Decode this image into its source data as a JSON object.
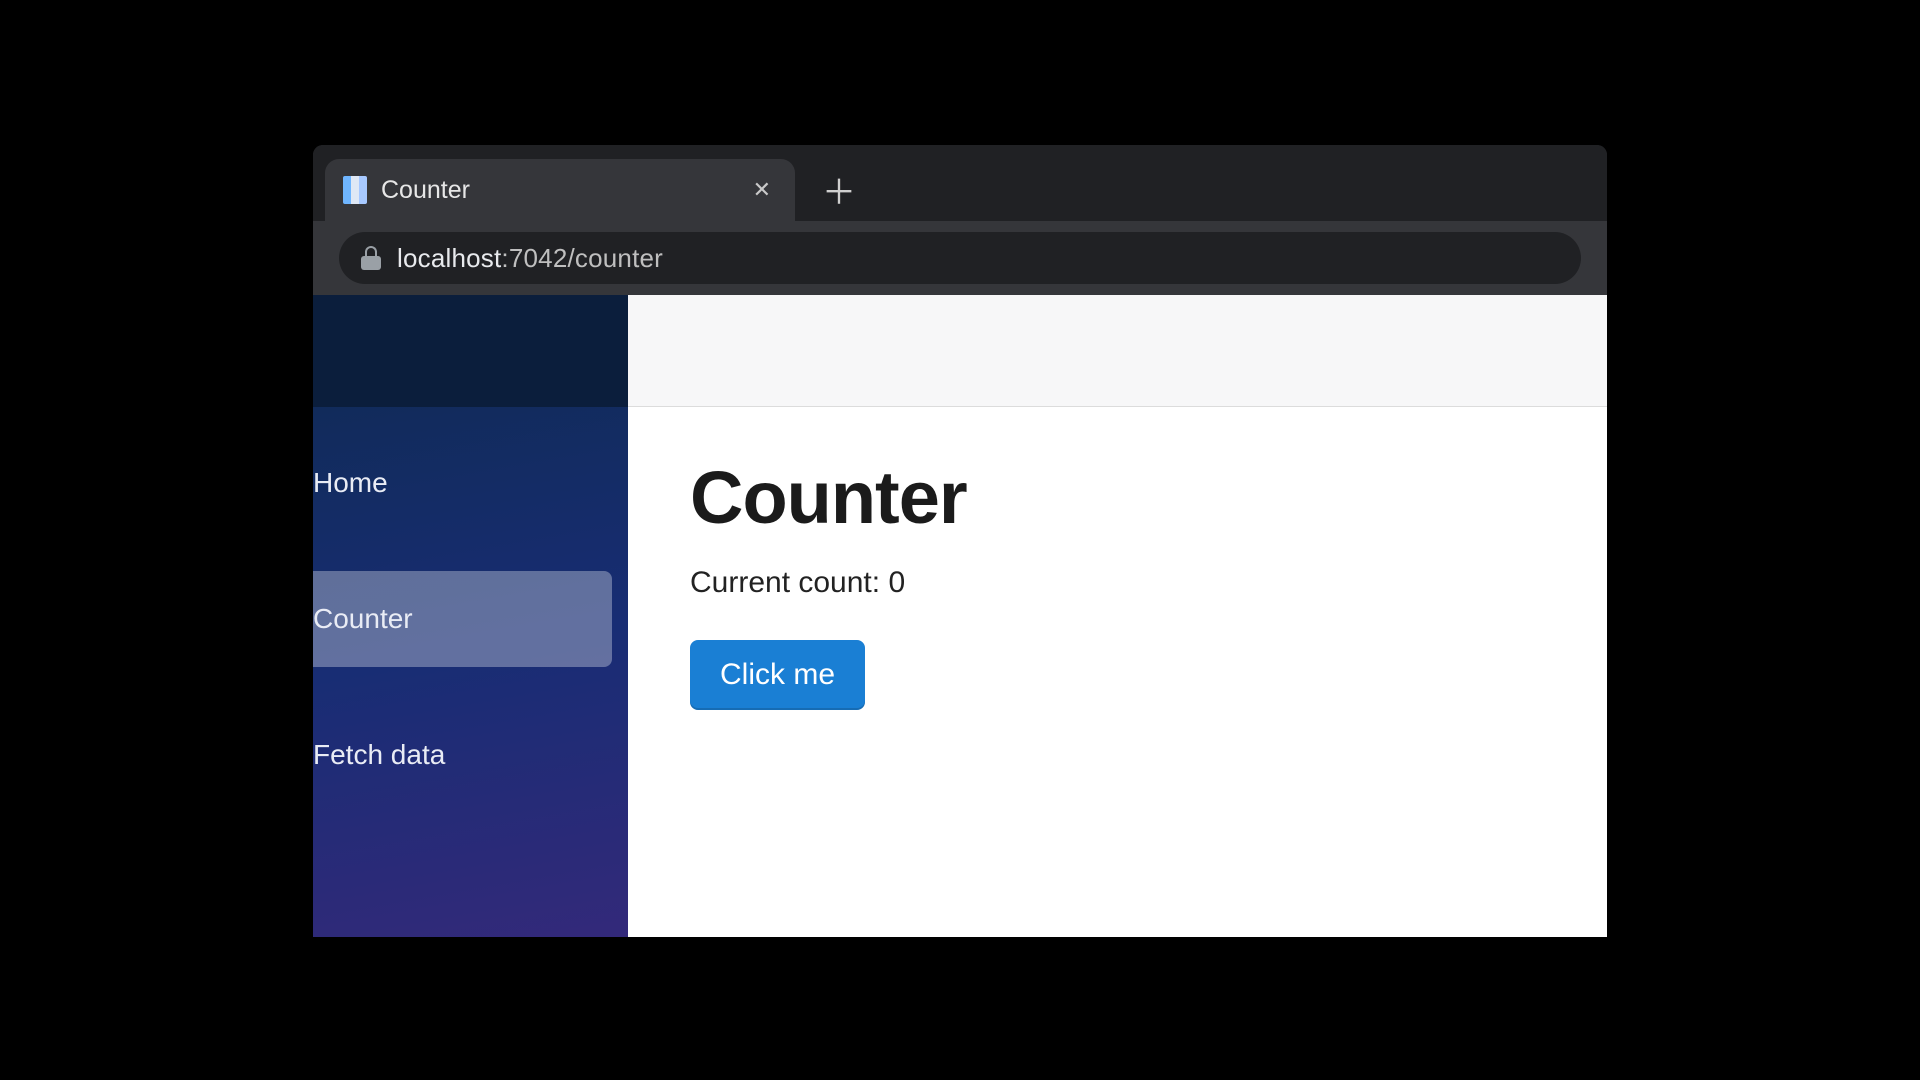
{
  "browser": {
    "tab_title": "Counter",
    "url_host": "localhost",
    "url_rest": ":7042/counter",
    "close_glyph": "✕",
    "plus_glyph": "＋"
  },
  "sidebar": {
    "items": [
      {
        "label": "Home",
        "active": false
      },
      {
        "label": "Counter",
        "active": true
      },
      {
        "label": "Fetch data",
        "active": false
      }
    ]
  },
  "page": {
    "title": "Counter",
    "count_label": "Current count: ",
    "count_value": "0",
    "button_label": "Click me"
  }
}
